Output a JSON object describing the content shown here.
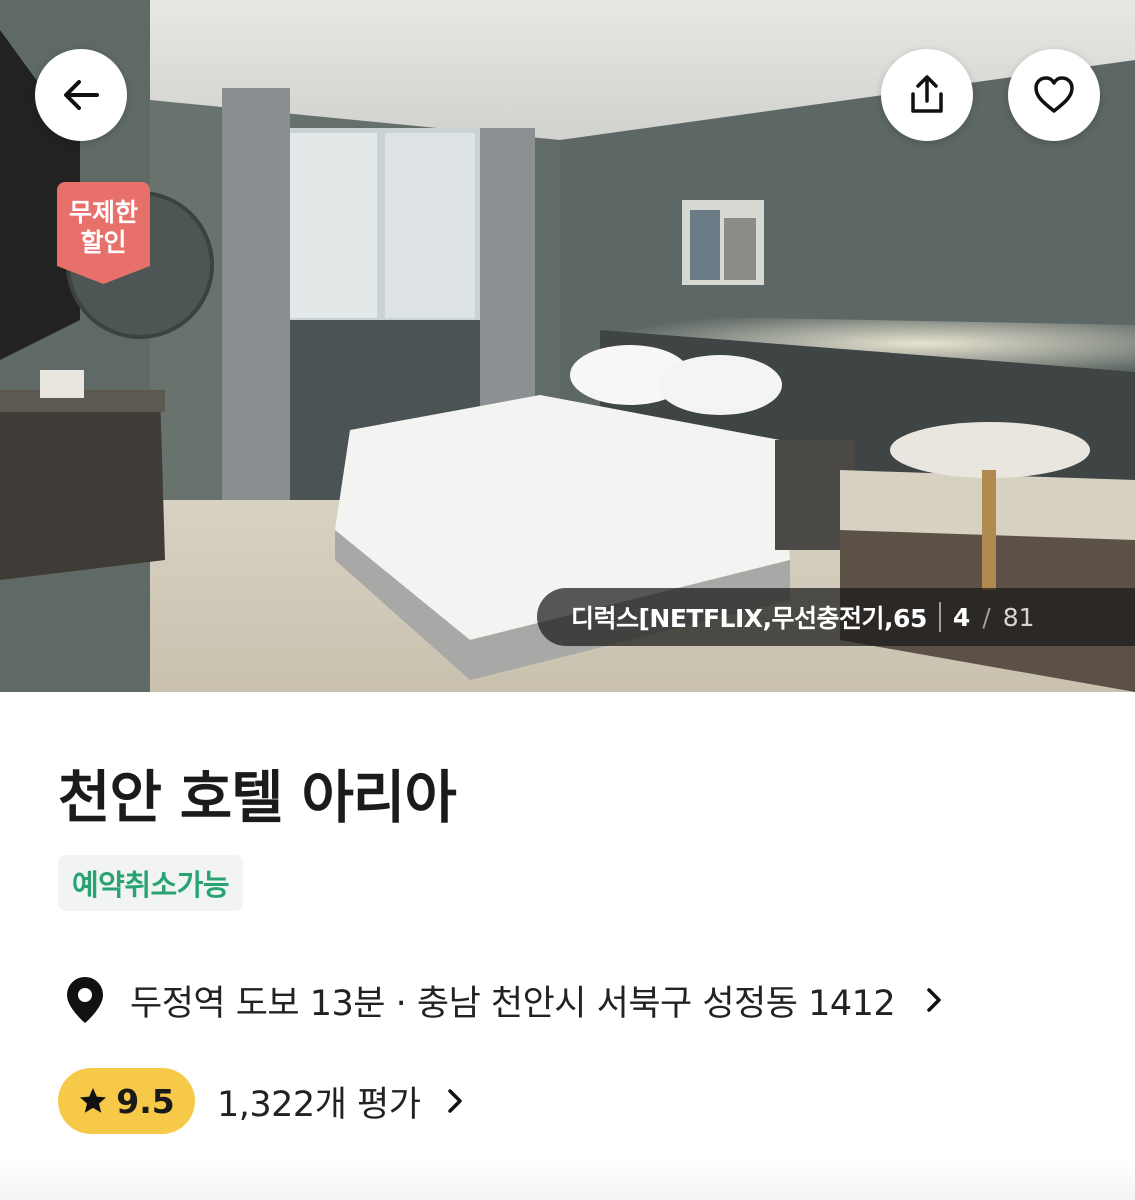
{
  "header": {
    "back_icon": "arrow-left-icon",
    "share_icon": "share-upload-icon",
    "favorite_icon": "heart-outline-icon"
  },
  "gallery": {
    "promo_badge_line1": "무제한",
    "promo_badge_line2": "할인",
    "room_caption": "디럭스[NETFLIX,무선충전기,65",
    "current_index": "4",
    "separator": "/",
    "total_count": "81"
  },
  "hotel": {
    "name": "천안 호텔 아리아",
    "tag": "예약취소가능",
    "location_text": "두정역 도보 13분 · 충남 천안시 서북구 성정동 1412",
    "location_icon": "map-pin-icon",
    "rating_icon": "star-icon",
    "rating_score": "9.5",
    "review_count_text": "1,322개 평가"
  },
  "colors": {
    "tag_text": "#2aa374",
    "tag_bg": "#f2f4f3",
    "rating_pill": "#f7c948",
    "promo_badge": "#e8706a"
  }
}
